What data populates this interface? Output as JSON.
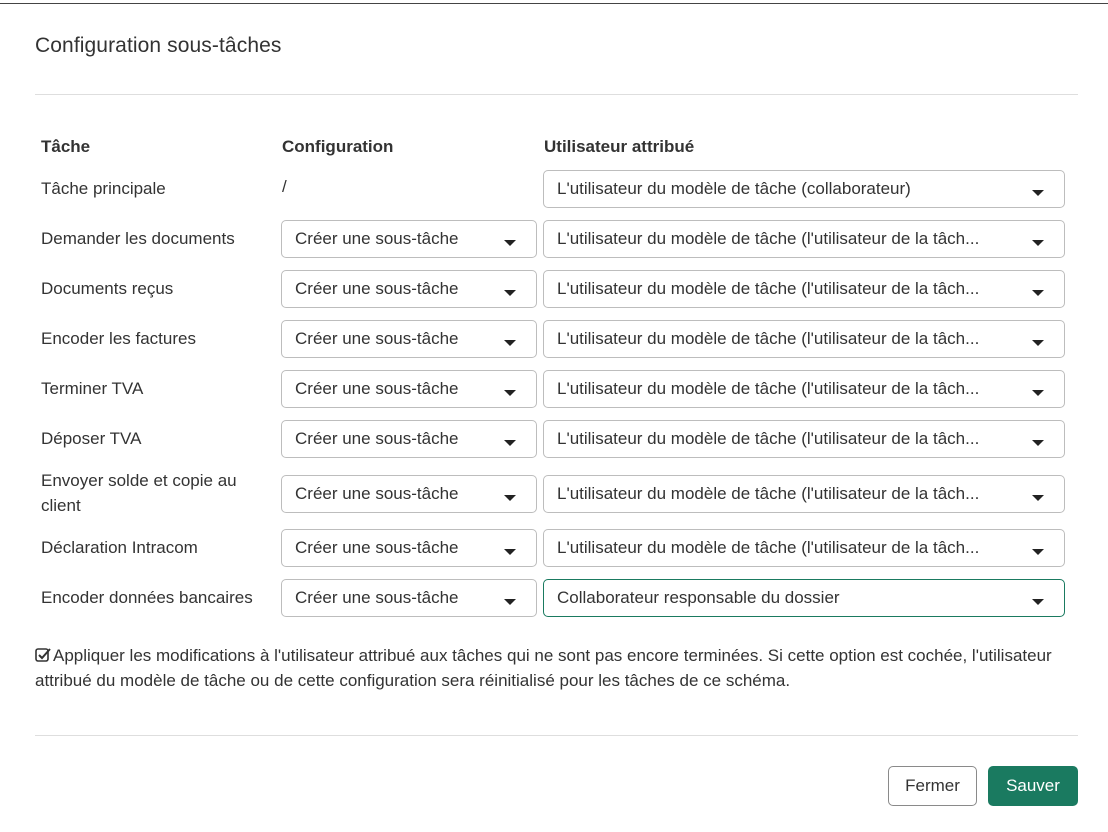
{
  "modal": {
    "title": "Configuration sous-tâches"
  },
  "table": {
    "headers": {
      "task": "Tâche",
      "configuration": "Configuration",
      "assigned_user": "Utilisateur attribué"
    },
    "rows": [
      {
        "task": "Tâche principale",
        "configuration": "/",
        "assigned_user": "L'utilisateur du modèle de tâche (collaborateur)"
      },
      {
        "task": "Demander les documents",
        "configuration": "Créer une sous-tâche",
        "assigned_user": "L'utilisateur du modèle de tâche (l'utilisateur de la tâch..."
      },
      {
        "task": "Documents reçus",
        "configuration": "Créer une sous-tâche",
        "assigned_user": "L'utilisateur du modèle de tâche (l'utilisateur de la tâch..."
      },
      {
        "task": "Encoder les factures",
        "configuration": "Créer une sous-tâche",
        "assigned_user": "L'utilisateur du modèle de tâche (l'utilisateur de la tâch..."
      },
      {
        "task": "Terminer TVA",
        "configuration": "Créer une sous-tâche",
        "assigned_user": "L'utilisateur du modèle de tâche (l'utilisateur de la tâch..."
      },
      {
        "task": "Déposer TVA",
        "configuration": "Créer une sous-tâche",
        "assigned_user": "L'utilisateur du modèle de tâche (l'utilisateur de la tâch..."
      },
      {
        "task": "Envoyer solde et copie au client",
        "configuration": "Créer une sous-tâche",
        "assigned_user": "L'utilisateur du modèle de tâche (l'utilisateur de la tâch..."
      },
      {
        "task": "Déclaration Intracom",
        "configuration": "Créer une sous-tâche",
        "assigned_user": "L'utilisateur du modèle de tâche (l'utilisateur de la tâch..."
      },
      {
        "task": "Encoder données bancaires",
        "configuration": "Créer une sous-tâche",
        "assigned_user": "Collaborateur responsable du dossier"
      }
    ]
  },
  "apply_option": {
    "checked": true,
    "text": "Appliquer les modifications à l'utilisateur attribué aux tâches qui ne sont pas encore terminées. Si cette option est cochée, l'utilisateur attribué du modèle de tâche ou de cette configuration sera réinitialisé pour les tâches de ce schéma."
  },
  "footer": {
    "close_label": "Fermer",
    "save_label": "Sauver"
  },
  "colors": {
    "accent": "#1a7a60",
    "text": "#333333",
    "border": "#bdbdbd"
  },
  "icons": {
    "dropdown": "caret-down-icon",
    "checkbox": "checkbox-checked-icon"
  }
}
